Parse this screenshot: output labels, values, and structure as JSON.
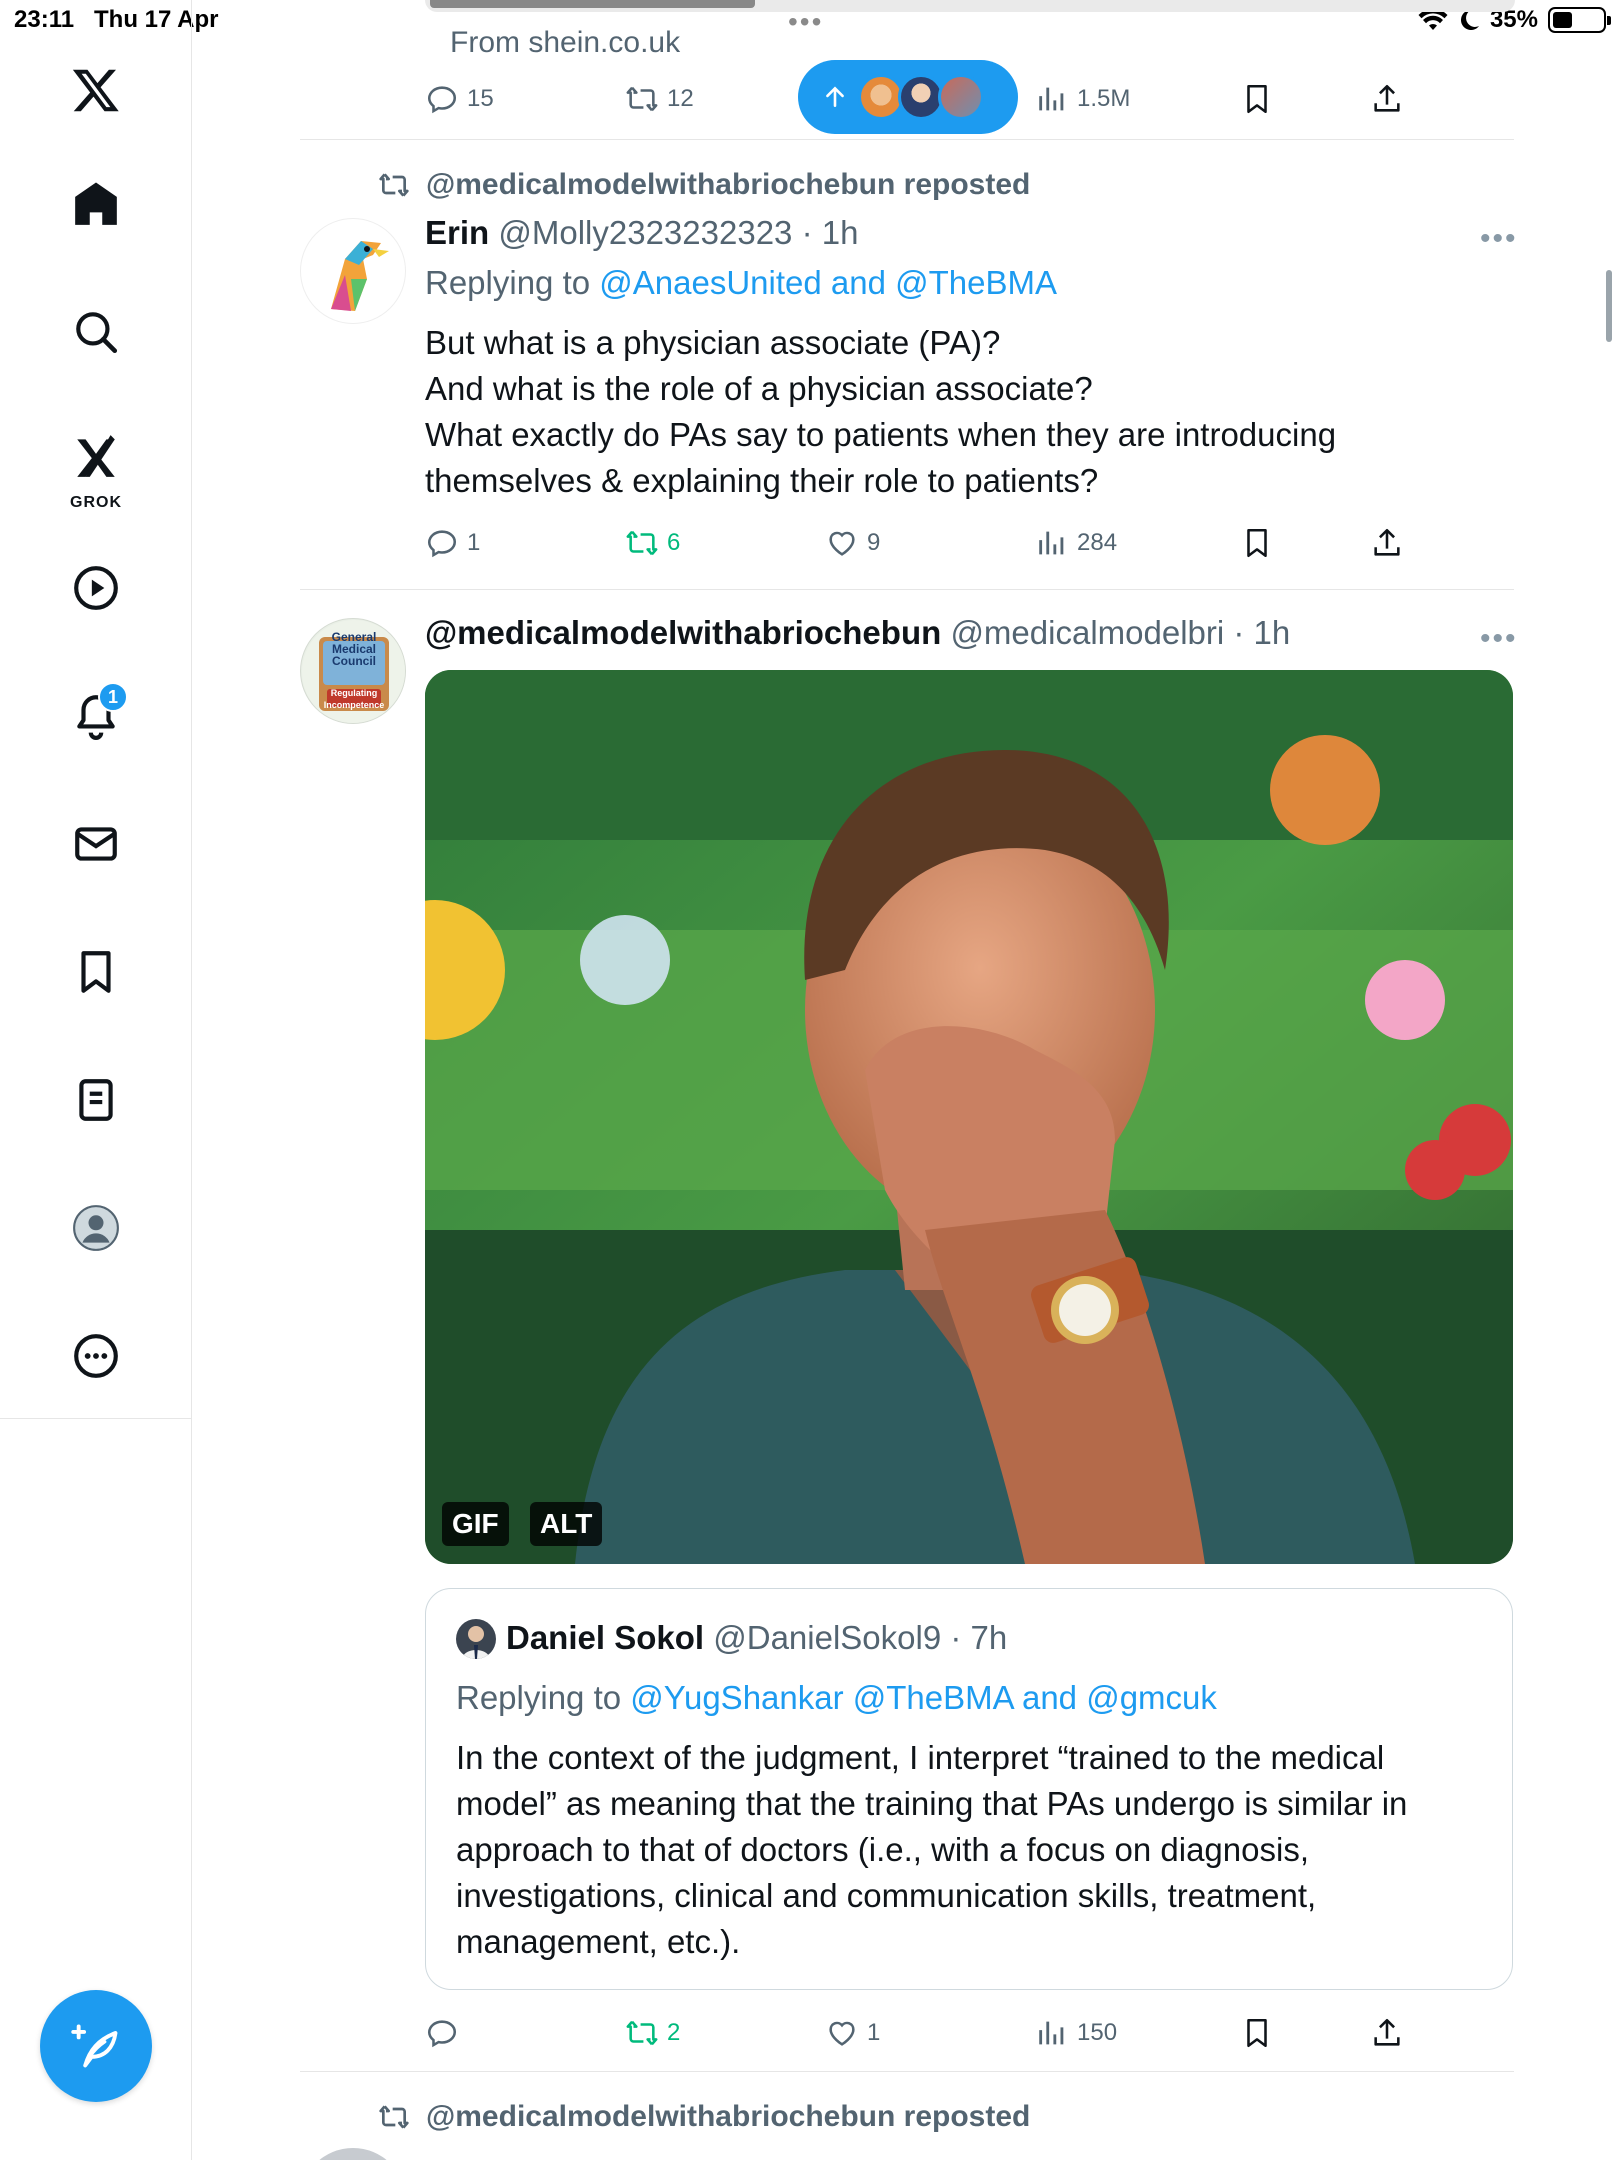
{
  "status_bar": {
    "time": "23:11",
    "date": "Thu 17 Apr",
    "battery": "35%",
    "battery_level": 0.35
  },
  "sidebar": {
    "grok_label": "GROK",
    "notifications_badge": "1"
  },
  "top_post": {
    "source": "From shein.co.uk",
    "replies": "15",
    "reposts": "12",
    "views": "1.5M"
  },
  "post1": {
    "reposted_by": "@medicalmodelwithabriochebun reposted",
    "name": "Erin",
    "handle_time": "@Molly2323232323 · 1h",
    "replying_prefix": "Replying to",
    "replying_to": "@AnaesUnited and @TheBMA",
    "text": "But what is a physician associate (PA)?\nAnd what is the role of a physician associate?\nWhat exactly do PAs say to patients when they are introducing themselves & explaining their role to patients?",
    "replies": "1",
    "reposts": "6",
    "likes": "9",
    "views": "284"
  },
  "post2": {
    "name": "@medicalmodelwithabriochebun",
    "handle_time": "@medicalmodelbri · 1h",
    "avatar_text": [
      "General",
      "Medical",
      "Council",
      "Regulating",
      "Incompetence"
    ],
    "media_tags": {
      "gif": "GIF",
      "alt": "ALT"
    },
    "quote": {
      "name": "Daniel Sokol",
      "handle_time": "@DanielSokol9 · 7h",
      "replying_prefix": "Replying to",
      "replying_to": "@YugShankar @TheBMA and @gmcuk",
      "text": "In the context of the judgment, I interpret “trained to the medical model” as meaning that the training that PAs undergo is similar in approach to that of doctors (i.e., with a focus on diagnosis, investigations, clinical and communication skills, treatment, management, etc.)."
    },
    "reposts": "2",
    "likes": "1",
    "views": "150"
  },
  "post3": {
    "reposted_by": "@medicalmodelwithabriochebun reposted"
  },
  "colors": {
    "accent": "#1d9bf0",
    "repost_green": "#00ba7c",
    "muted": "#536471",
    "divider": "#e6e6e6"
  }
}
